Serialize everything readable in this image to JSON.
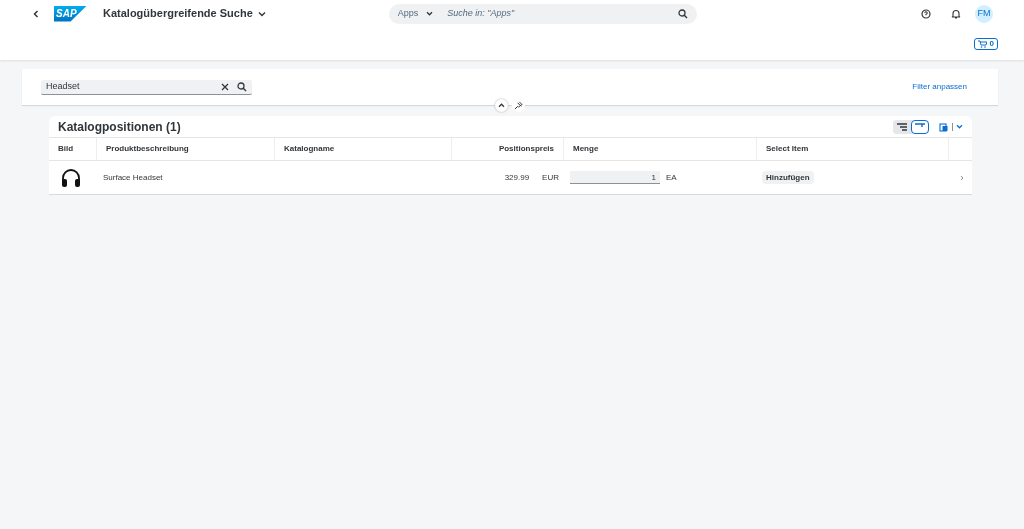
{
  "shell": {
    "logo": "SAP",
    "app_title": "Katalogübergreifende Suche",
    "search": {
      "scope": "Apps",
      "placeholder": "Suche in: \"Apps\""
    },
    "avatar": "FM",
    "cart_count": "0"
  },
  "filter_bar": {
    "search_value": "Headset",
    "adapt_link": "Filter anpassen"
  },
  "table": {
    "title": "Katalogpositionen (1)",
    "view_toggles": [
      {
        "kind": "tree",
        "selected": false
      },
      {
        "kind": "flat",
        "selected": true
      }
    ],
    "columns": [
      "Bild",
      "Produktbeschreibung",
      "Katalogname",
      "Positionspreis",
      "Menge",
      "Select Item"
    ],
    "rows": [
      {
        "description": "Surface Headset",
        "price": "329.99",
        "currency": "EUR",
        "quantity": "1",
        "unit": "EA",
        "action": "Hinzufügen"
      }
    ]
  }
}
